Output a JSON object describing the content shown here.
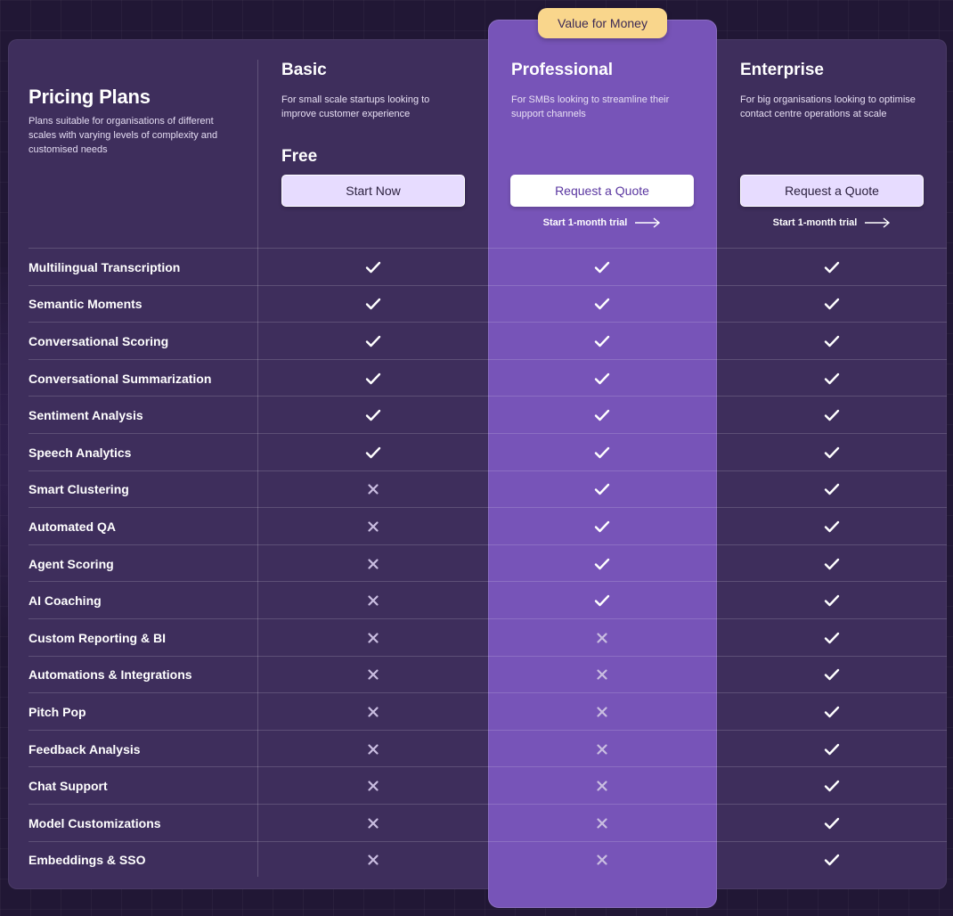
{
  "badge": "Value for Money",
  "intro": {
    "title": "Pricing Plans",
    "description": "Plans suitable for organisations of different scales with varying levels of complexity and customised needs"
  },
  "plans": [
    {
      "name": "Basic",
      "description": "For small scale startups looking to improve customer experience",
      "price": "Free",
      "cta": "Start Now",
      "trial": ""
    },
    {
      "name": "Professional",
      "description": "For SMBs looking to streamline their support channels",
      "price": "",
      "cta": "Request a Quote",
      "trial": "Start 1-month trial"
    },
    {
      "name": "Enterprise",
      "description": "For big organisations looking to optimise contact centre operations at scale",
      "price": "",
      "cta": "Request a Quote",
      "trial": "Start 1-month trial"
    }
  ],
  "features": [
    {
      "name": "Multilingual Transcription",
      "basic": true,
      "professional": true,
      "enterprise": true
    },
    {
      "name": "Semantic Moments",
      "basic": true,
      "professional": true,
      "enterprise": true
    },
    {
      "name": "Conversational Scoring",
      "basic": true,
      "professional": true,
      "enterprise": true
    },
    {
      "name": "Conversational Summarization",
      "basic": true,
      "professional": true,
      "enterprise": true
    },
    {
      "name": "Sentiment Analysis",
      "basic": true,
      "professional": true,
      "enterprise": true
    },
    {
      "name": "Speech Analytics",
      "basic": true,
      "professional": true,
      "enterprise": true
    },
    {
      "name": "Smart Clustering",
      "basic": false,
      "professional": true,
      "enterprise": true
    },
    {
      "name": "Automated QA",
      "basic": false,
      "professional": true,
      "enterprise": true
    },
    {
      "name": "Agent Scoring",
      "basic": false,
      "professional": true,
      "enterprise": true
    },
    {
      "name": "AI Coaching",
      "basic": false,
      "professional": true,
      "enterprise": true
    },
    {
      "name": "Custom Reporting & BI",
      "basic": false,
      "professional": false,
      "enterprise": true
    },
    {
      "name": "Automations & Integrations",
      "basic": false,
      "professional": false,
      "enterprise": true
    },
    {
      "name": "Pitch Pop",
      "basic": false,
      "professional": false,
      "enterprise": true
    },
    {
      "name": "Feedback Analysis",
      "basic": false,
      "professional": false,
      "enterprise": true
    },
    {
      "name": "Chat Support",
      "basic": false,
      "professional": false,
      "enterprise": true
    },
    {
      "name": "Model Customizations",
      "basic": false,
      "professional": false,
      "enterprise": true
    },
    {
      "name": "Embeddings & SSO",
      "basic": false,
      "professional": false,
      "enterprise": true
    }
  ],
  "icons": {
    "included": "check-icon",
    "excluded": "cross-icon",
    "trial_arrow": "arrow-right-icon"
  },
  "colors": {
    "background": "#211735",
    "card": "#3e2e5c",
    "highlight": "#7754b8",
    "badge": "#f9d68c",
    "button_lavender": "#e7dcff"
  }
}
